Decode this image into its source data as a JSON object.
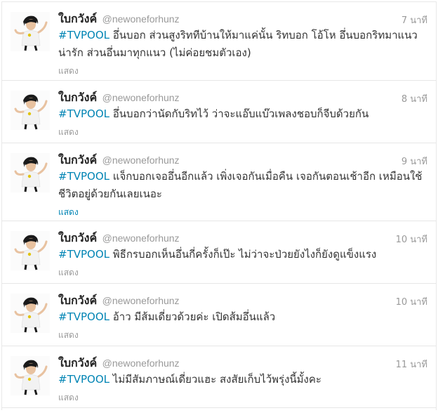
{
  "tweets": [
    {
      "name": "ใบกวังค์",
      "handle": "@newoneforhunz",
      "time": "7 นาที",
      "hashtag": "#TVPOOL",
      "text": "อึ่นบอก ส่วนสูงริททีบ้านให้มาแค่นั้น ริทบอก โอ้โห อึ่นบอกริทมาแนวน่ารัก ส่วนอึ่นมาทุกแนว (ไม่ค่อยชมตัวเอง)",
      "show": "แสดง"
    },
    {
      "name": "ใบกวังค์",
      "handle": "@newoneforhunz",
      "time": "8 นาที",
      "hashtag": "#TVPOOL",
      "text": "อึ่นบอกว่านัดกับริทไว้ ว่าจะแอ๊บแบ๊วเพลงชอบก็จีบด้วยกัน",
      "show": "แสดง"
    },
    {
      "name": "ใบกวังค์",
      "handle": "@newoneforhunz",
      "time": "9 นาที",
      "hashtag": "#TVPOOL",
      "text": "แจ็กบอกเจออึ่นอีกแล้ว เพิ่งเจอกันเมื่อคืน เจอกันตอนเช้าอีก เหมือนใช้ชีวิตอยู่ด้วยกันเลยเนอะ",
      "show": "แสดง"
    },
    {
      "name": "ใบกวังค์",
      "handle": "@newoneforhunz",
      "time": "10 นาที",
      "hashtag": "#TVPOOL",
      "text": "พิธีกรบอกเห็นอึ่นกี่ครั้งก็เป๊ะ ไม่ว่าจะป่วยยังไงก็ยังดูแข็งแรง",
      "show": "แสดง"
    },
    {
      "name": "ใบกวังค์",
      "handle": "@newoneforhunz",
      "time": "10 นาที",
      "hashtag": "#TVPOOL",
      "text": "อ้าว มีส้มเดี่ยวด้วยค่ะ เปิดส้มอึ่นแล้ว",
      "show": "แสดง"
    },
    {
      "name": "ใบกวังค์",
      "handle": "@newoneforhunz",
      "time": "11 นาที",
      "hashtag": "#TVPOOL",
      "text": "ไม่มีสัมภาษณ์เดี่ยวแฮะ สงสัยเก็บไว้พรุ่งนี้มั้งคะ",
      "show": "แสดง"
    }
  ],
  "colors": {
    "hashtag": "#0084b4",
    "muted": "#999999",
    "text": "#333333",
    "divider": "#e6e6e6"
  }
}
